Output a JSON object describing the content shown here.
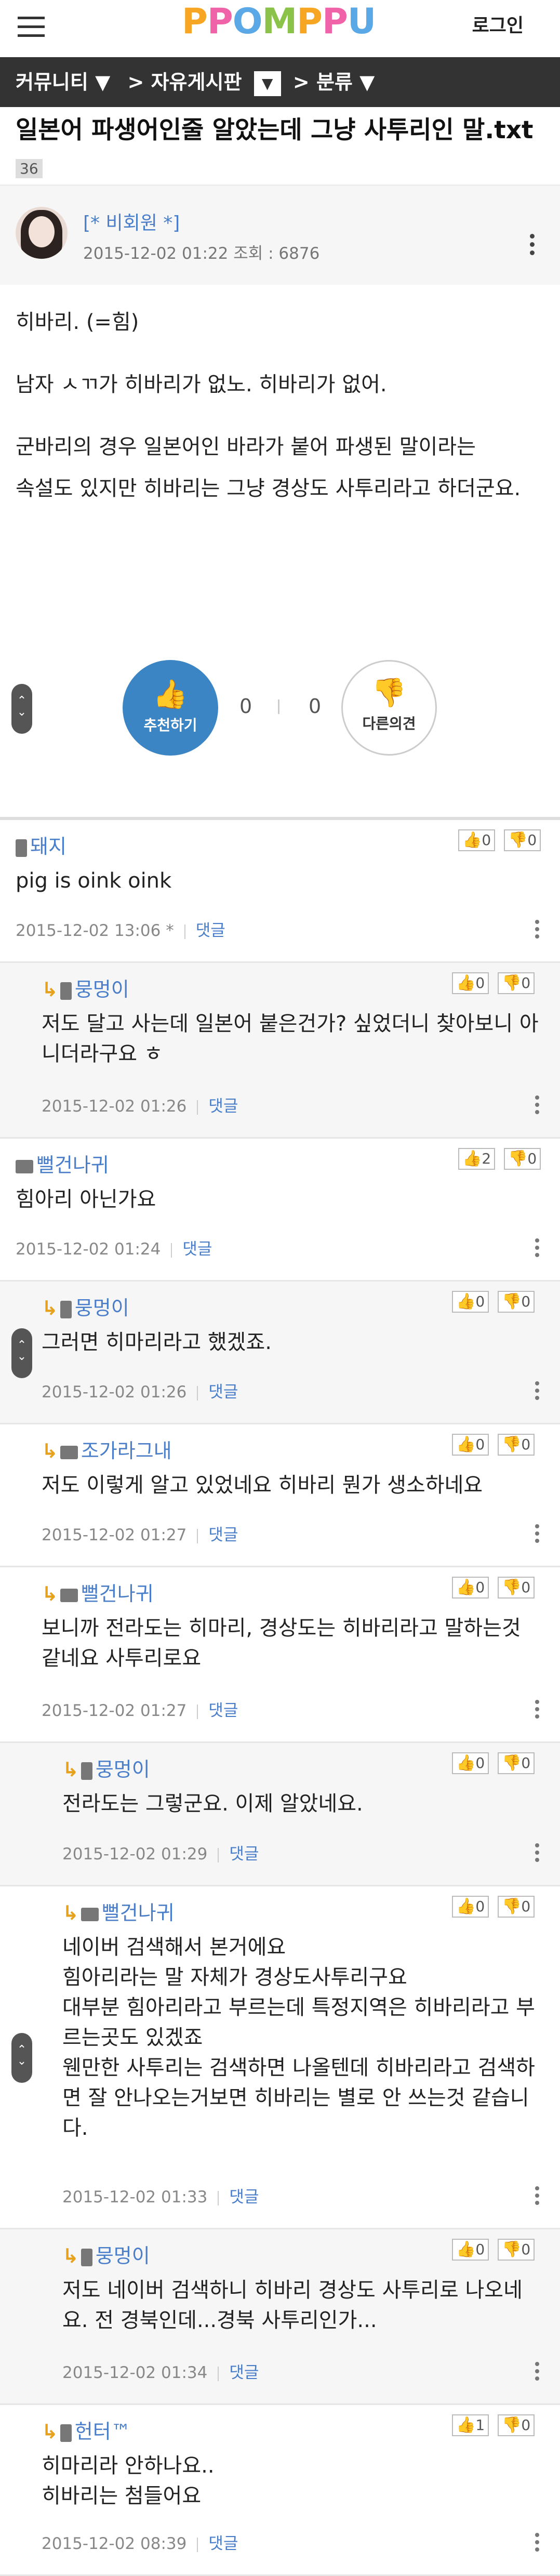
{
  "header": {
    "logo": "PPOMPPU",
    "logo_colors": [
      "#f6a623",
      "#f163a8",
      "#5aa9e6",
      "#8bc34a",
      "#f6a623",
      "#f163a8",
      "#5aa9e6"
    ],
    "login": "로그인"
  },
  "category": {
    "items": [
      "커뮤니티 ▼",
      "> 자유게시판",
      "▼",
      "> 분류 ▼"
    ]
  },
  "post": {
    "title": "일본어 파생어인줄 알았는데 그냥 사투리인 말.txt",
    "comment_count": "36",
    "author": "[* 비회원 *]",
    "meta": "2015-12-02 01:22  조회 : 6876",
    "body": [
      "히바리. (=힘)",
      "남자 ㅅㄲ가 히바리가 없노. 히바리가 없어.",
      "군바리의 경우 일본어인 바라가 붙어 파생된 말이라는",
      "속설도 있지만 히바리는 그냥 경상도 사투리라고 하더군요."
    ],
    "recommend_label": "추천하기",
    "recommend_count": "0",
    "oppose_count": "0",
    "oppose_label": "다른의견"
  },
  "comments": [
    {
      "name": "돼지",
      "text": "pig is oink oink",
      "date": "2015-12-02 13:06",
      "mark": "*",
      "reply": "댓글",
      "up": "0",
      "down": "0"
    },
    {
      "name": "뭉멍이",
      "text": "저도 달고 사는데 일본어 붙은건가? 싶었더니 찾아보니 아니더라구요 ㅎ",
      "date": "2015-12-02 01:26",
      "reply": "댓글",
      "up": "0",
      "down": "0"
    },
    {
      "name": "뻘건나귀",
      "text": "힘아리 아닌가요",
      "date": "2015-12-02 01:24",
      "reply": "댓글",
      "up": "2",
      "down": "0"
    },
    {
      "name": "뭉멍이",
      "text": "그러면 히마리라고 했겠죠.",
      "date": "2015-12-02 01:26",
      "reply": "댓글",
      "up": "0",
      "down": "0"
    },
    {
      "name": "조가라그내",
      "text": "저도 이렇게 알고 있었네요 히바리 뭔가 생소하네요",
      "date": "2015-12-02 01:27",
      "reply": "댓글",
      "up": "0",
      "down": "0"
    },
    {
      "name": "뻘건나귀",
      "text": "보니까 전라도는 히마리, 경상도는 히바리라고 말하는것 같네요 사투리로요",
      "date": "2015-12-02 01:27",
      "reply": "댓글",
      "up": "0",
      "down": "0"
    },
    {
      "name": "뭉멍이",
      "text": "전라도는 그렇군요. 이제 알았네요.",
      "date": "2015-12-02 01:29",
      "reply": "댓글",
      "up": "0",
      "down": "0"
    },
    {
      "name": "뻘건나귀",
      "text_lines": [
        "네이버 검색해서 본거에요",
        "힘아리라는 말 자체가 경상도사투리구요",
        "대부분 힘아리라고 부르는데 특정지역은 히바리라고 부르는곳도 있겠죠",
        "웬만한 사투리는 검색하면 나올텐데 히바리라고 검색하면 잘 안나오는거보면 히바리는 별로 안 쓰는것 같습니다."
      ],
      "date": "2015-12-02 01:33",
      "reply": "댓글",
      "up": "0",
      "down": "0"
    },
    {
      "name": "뭉멍이",
      "text": "저도 네이버 검색하니 히바리 경상도 사투리로 나오네요. 전 경북인데...경북 사투리인가...",
      "date": "2015-12-02 01:34",
      "reply": "댓글",
      "up": "0",
      "down": "0"
    },
    {
      "name": "헌터™",
      "text_lines": [
        "히마리라 안하나요..",
        "히바리는 첨들어요"
      ],
      "date": "2015-12-02 08:39",
      "reply": "댓글",
      "up": "1",
      "down": "0"
    }
  ]
}
